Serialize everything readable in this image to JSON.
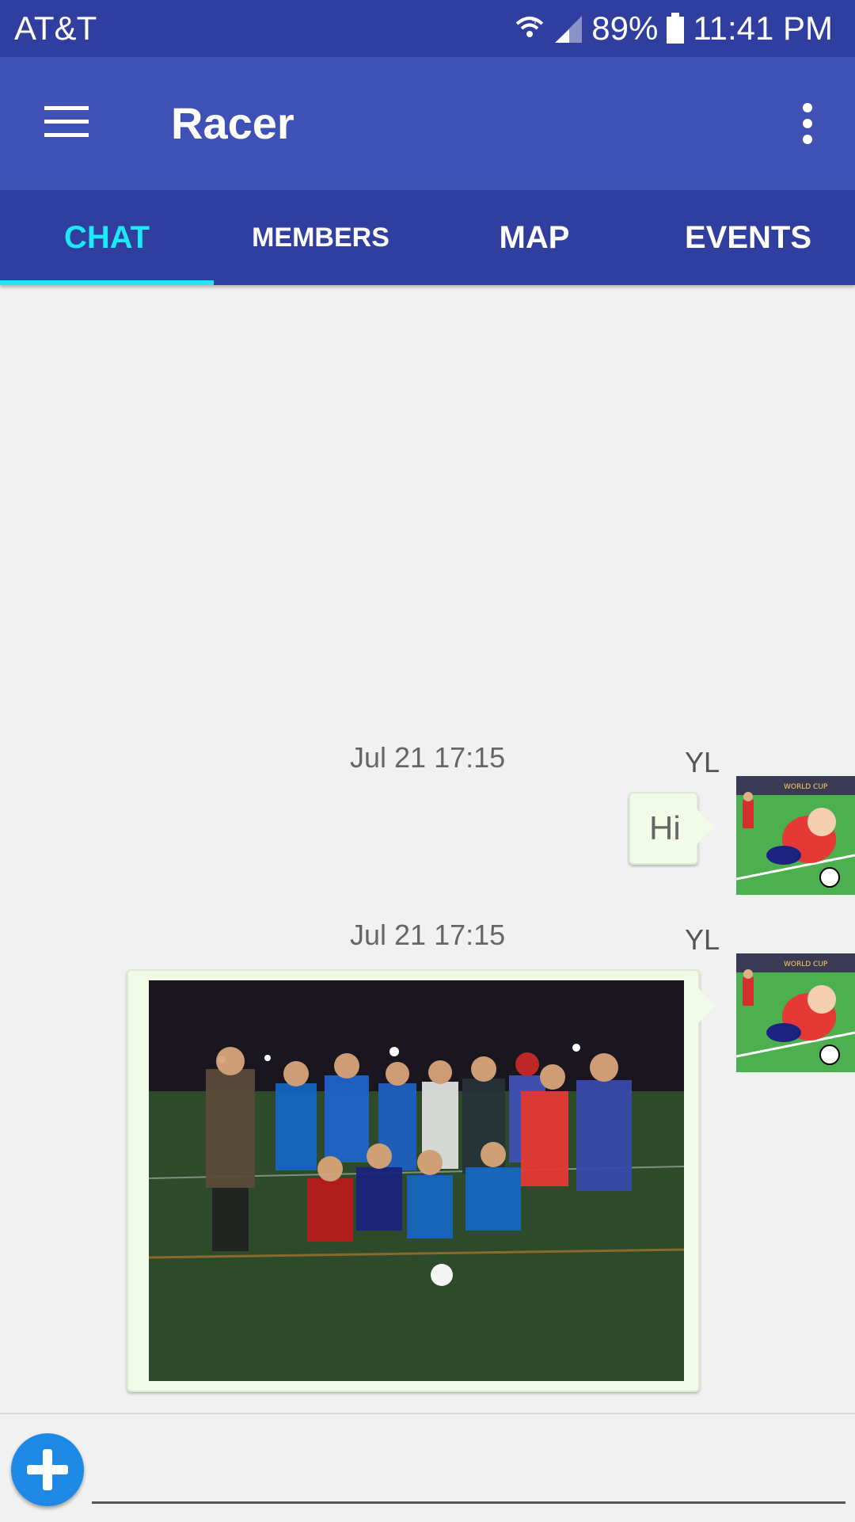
{
  "status_bar": {
    "carrier": "AT&T",
    "battery": "89%",
    "time": "11:41 PM",
    "icons": [
      "wifi-calling-icon",
      "signal-icon",
      "battery-icon"
    ]
  },
  "app_bar": {
    "title": "Racer",
    "icons": [
      "hamburger-menu-icon",
      "more-vert-icon"
    ]
  },
  "tabs": [
    {
      "label": "CHAT",
      "active": true
    },
    {
      "label": "MEMBERS",
      "active": false
    },
    {
      "label": "MAP",
      "active": false
    },
    {
      "label": "EVENTS",
      "active": false
    }
  ],
  "messages": [
    {
      "timestamp": "Jul 21 17:15",
      "sender": "YL",
      "type": "text",
      "text": "Hi"
    },
    {
      "timestamp": "Jul 21 17:15",
      "sender": "YL",
      "type": "image"
    }
  ],
  "composer": {
    "placeholder": "",
    "add_icon": "add-circle-icon"
  },
  "colors": {
    "status_bar": "#303f9f",
    "app_bar": "#3f51b5",
    "tab_bar": "#303f9f",
    "tab_active": "#1de9f6",
    "bubble": "#f1fbe8",
    "fab": "#1e88e5"
  }
}
